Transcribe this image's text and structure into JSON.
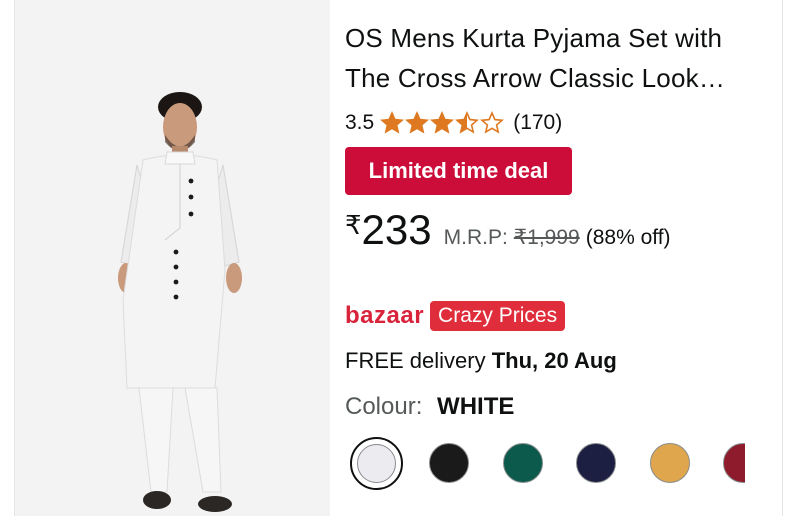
{
  "product": {
    "title_line1": "OS Mens Kurta Pyjama Set with",
    "title_line2": "The Cross Arrow Classic Look…",
    "rating": "3.5",
    "rating_stars": 3.5,
    "rating_count": "(170)",
    "deal_badge": "Limited time deal",
    "currency_symbol": "₹",
    "price": "233",
    "mrp_label": "M.R.P:",
    "mrp_value": "₹1,999",
    "discount": "(88% off)",
    "bazaar_logo": "bazaar",
    "bazaar_badge": "Crazy Prices",
    "delivery_prefix": "FREE delivery",
    "delivery_date": "Thu, 20 Aug",
    "colour_label": "Colour:",
    "colour_value": "WHITE"
  },
  "swatches": [
    {
      "name": "white",
      "color": "#ececf0",
      "selected": true
    },
    {
      "name": "black",
      "color": "#1a1a1a",
      "selected": false
    },
    {
      "name": "teal",
      "color": "#0b5a4c",
      "selected": false
    },
    {
      "name": "navy",
      "color": "#1c1f42",
      "selected": false
    },
    {
      "name": "mustard",
      "color": "#e0a64d",
      "selected": false
    },
    {
      "name": "maroon",
      "color": "#8e1b2c",
      "selected": false
    }
  ],
  "colors": {
    "star": "#de7921",
    "deal_red": "#cc0c39",
    "bazaar_red": "#d9233b"
  }
}
